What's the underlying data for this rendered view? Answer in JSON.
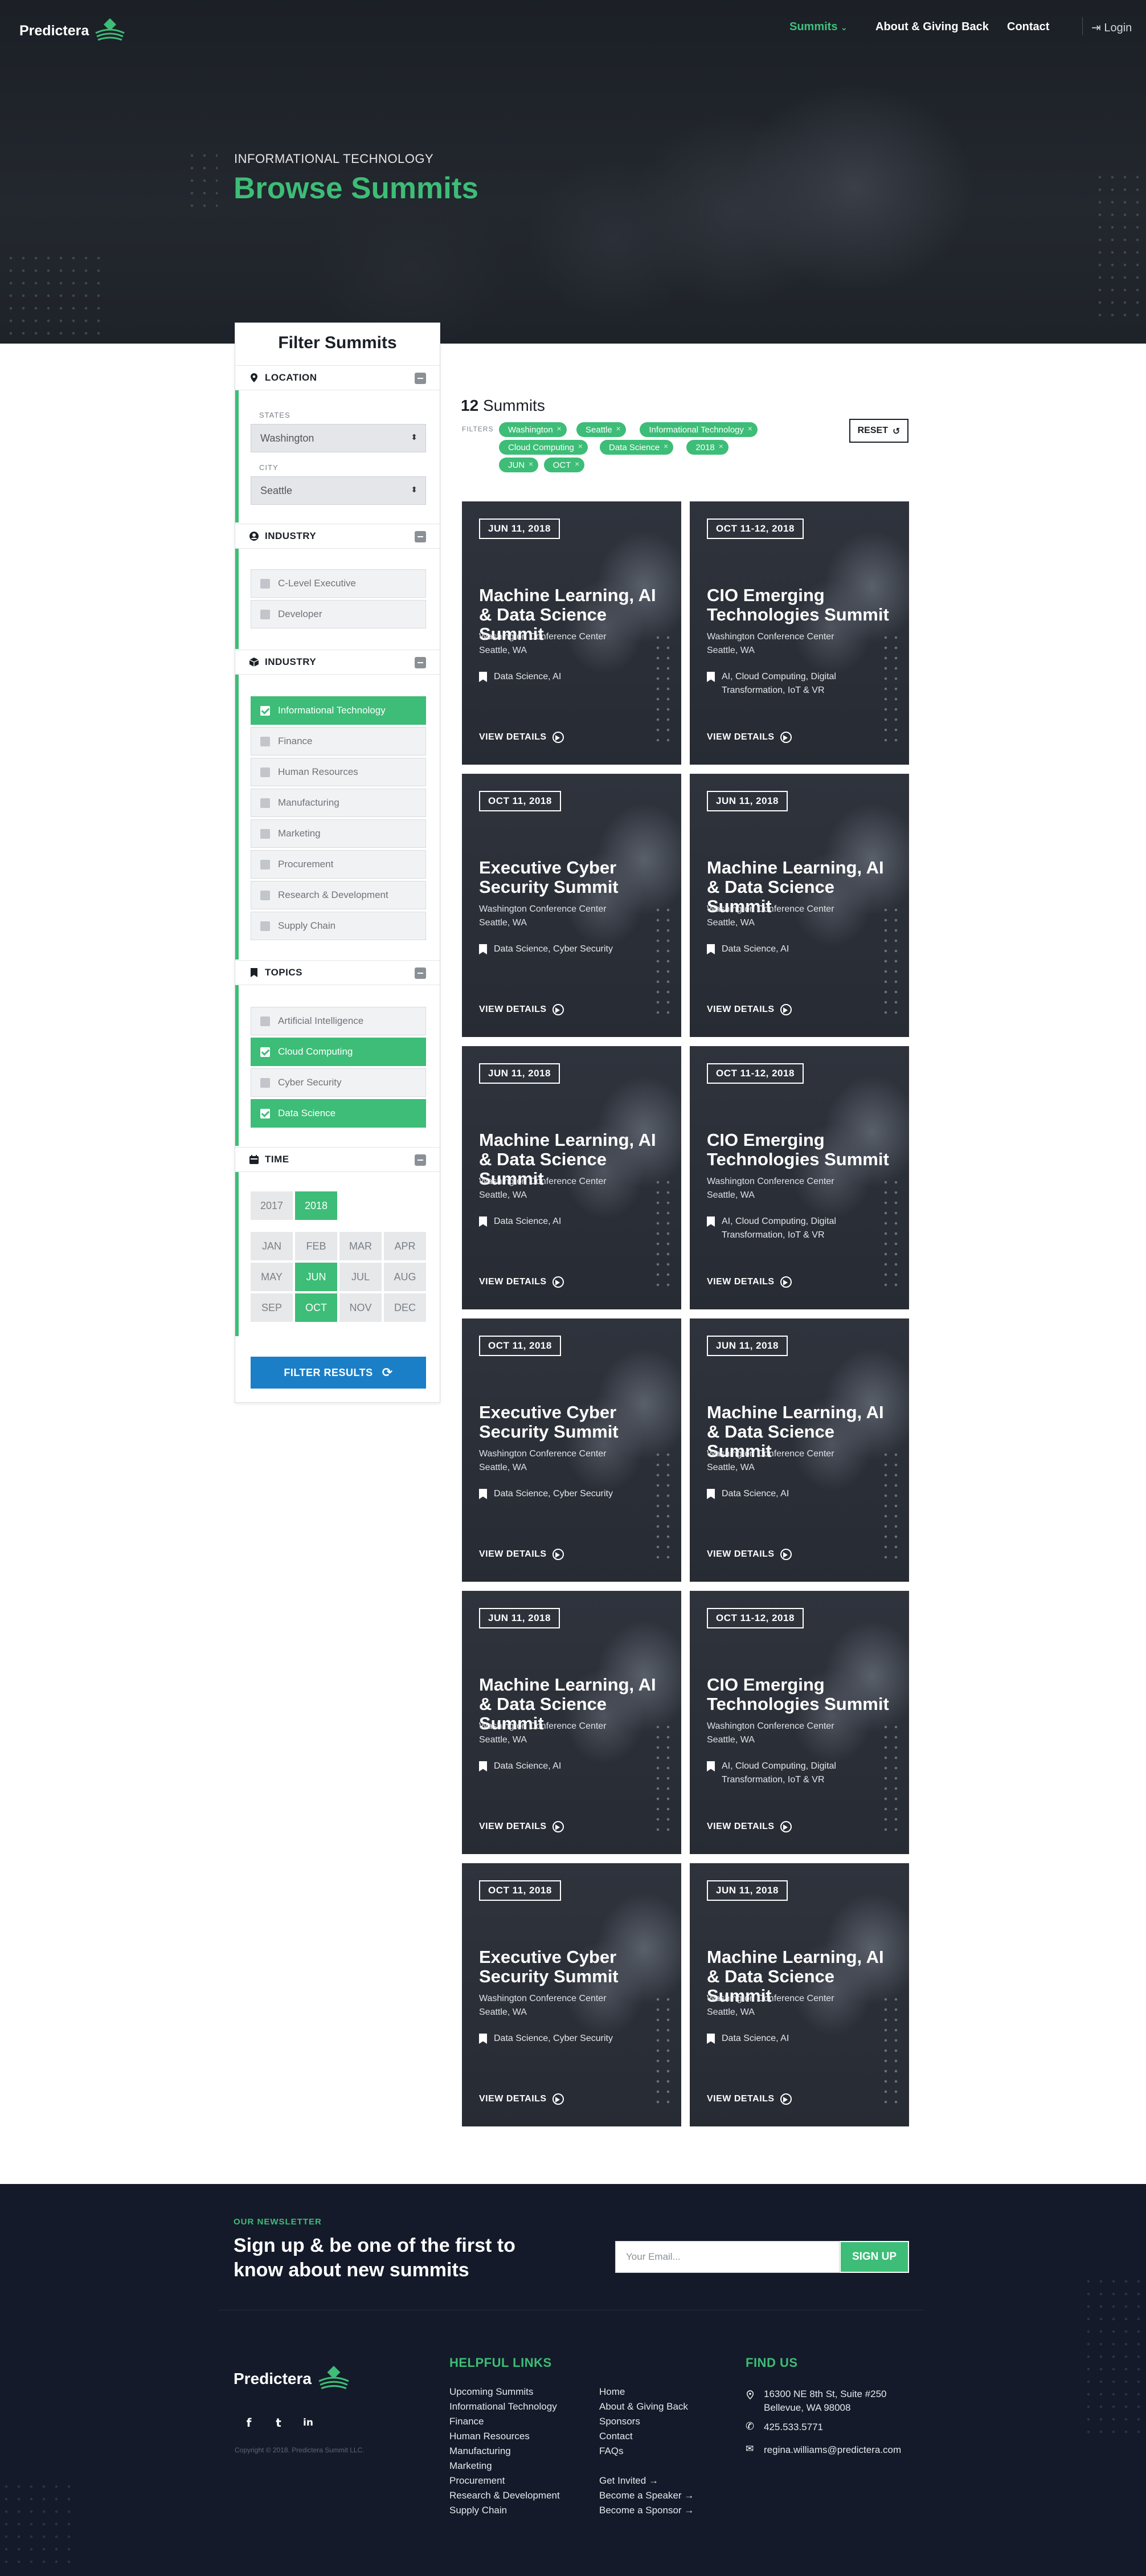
{
  "brand": {
    "name": "Predictera"
  },
  "nav": {
    "summits": "Summits",
    "about": "About & Giving Back",
    "contact": "Contact",
    "login": "Login"
  },
  "hero": {
    "kicker": "INFORMATIONAL TECHNOLOGY",
    "title": "Browse Summits"
  },
  "sidebar": {
    "title": "Filter Summits",
    "location": {
      "heading": "LOCATION",
      "states_label": "STATES",
      "states_value": "Washington",
      "city_label": "CITY",
      "city_value": "Seattle"
    },
    "role": {
      "heading": "INDUSTRY",
      "options": [
        {
          "label": "C-Level Executive",
          "checked": false
        },
        {
          "label": "Developer",
          "checked": false
        }
      ]
    },
    "industry": {
      "heading": "INDUSTRY",
      "options": [
        {
          "label": "Informational Technology",
          "checked": true
        },
        {
          "label": "Finance",
          "checked": false
        },
        {
          "label": "Human Resources",
          "checked": false
        },
        {
          "label": "Manufacturing",
          "checked": false
        },
        {
          "label": "Marketing",
          "checked": false
        },
        {
          "label": "Procurement",
          "checked": false
        },
        {
          "label": "Research & Development",
          "checked": false
        },
        {
          "label": "Supply Chain",
          "checked": false
        }
      ]
    },
    "topics": {
      "heading": "TOPICS",
      "options": [
        {
          "label": "Artificial Intelligence",
          "checked": false
        },
        {
          "label": "Cloud Computing",
          "checked": true
        },
        {
          "label": "Cyber Security",
          "checked": false
        },
        {
          "label": "Data Science",
          "checked": true
        }
      ]
    },
    "time": {
      "heading": "TIME",
      "years": [
        {
          "label": "2017",
          "selected": false
        },
        {
          "label": "2018",
          "selected": true
        }
      ],
      "months": [
        {
          "label": "JAN",
          "selected": false
        },
        {
          "label": "FEB",
          "selected": false
        },
        {
          "label": "MAR",
          "selected": false
        },
        {
          "label": "APR",
          "selected": false
        },
        {
          "label": "MAY",
          "selected": false
        },
        {
          "label": "JUN",
          "selected": true
        },
        {
          "label": "JUL",
          "selected": false
        },
        {
          "label": "AUG",
          "selected": false
        },
        {
          "label": "SEP",
          "selected": false
        },
        {
          "label": "OCT",
          "selected": true
        },
        {
          "label": "NOV",
          "selected": false
        },
        {
          "label": "DEC",
          "selected": false
        }
      ]
    },
    "filter_button": "FILTER RESULTS"
  },
  "results": {
    "count": "12",
    "count_label": "Summits",
    "filters_label": "FILTERS",
    "reset": "RESET",
    "tags": [
      "Washington",
      "Seattle",
      "Informational Technology",
      "Cloud Computing",
      "Data Science",
      "2018",
      "JUN",
      "OCT"
    ],
    "cards": [
      {
        "date": "JUN 11, 2018",
        "title": "Machine Learning, AI & Data Science Summit",
        "venue": "Washington Conference Center",
        "city": "Seattle, WA",
        "topics": "Data Science, AI",
        "cta": "VIEW DETAILS"
      },
      {
        "date": "OCT 11-12, 2018",
        "title": "CIO Emerging Technologies Summit",
        "venue": "Washington Conference Center",
        "city": "Seattle, WA",
        "topics": "AI, Cloud Computing, Digital Transformation, IoT & VR",
        "cta": "VIEW DETAILS"
      },
      {
        "date": "OCT 11, 2018",
        "title": "Executive Cyber Security Summit",
        "venue": "Washington Conference Center",
        "city": "Seattle, WA",
        "topics": "Data Science, Cyber Security",
        "cta": "VIEW DETAILS"
      },
      {
        "date": "JUN 11, 2018",
        "title": "Machine Learning, AI & Data Science Summit",
        "venue": "Washington Conference Center",
        "city": "Seattle, WA",
        "topics": "Data Science, AI",
        "cta": "VIEW DETAILS"
      },
      {
        "date": "JUN 11, 2018",
        "title": "Machine Learning, AI & Data Science Summit",
        "venue": "Washington Conference Center",
        "city": "Seattle, WA",
        "topics": "Data Science, AI",
        "cta": "VIEW DETAILS"
      },
      {
        "date": "OCT 11-12, 2018",
        "title": "CIO Emerging Technologies Summit",
        "venue": "Washington Conference Center",
        "city": "Seattle, WA",
        "topics": "AI, Cloud Computing, Digital Transformation, IoT & VR",
        "cta": "VIEW DETAILS"
      },
      {
        "date": "OCT 11, 2018",
        "title": "Executive Cyber Security Summit",
        "venue": "Washington Conference Center",
        "city": "Seattle, WA",
        "topics": "Data Science, Cyber Security",
        "cta": "VIEW DETAILS"
      },
      {
        "date": "JUN 11, 2018",
        "title": "Machine Learning, AI & Data Science Summit",
        "venue": "Washington Conference Center",
        "city": "Seattle, WA",
        "topics": "Data Science, AI",
        "cta": "VIEW DETAILS"
      },
      {
        "date": "JUN 11, 2018",
        "title": "Machine Learning, AI & Data Science Summit",
        "venue": "Washington Conference Center",
        "city": "Seattle, WA",
        "topics": "Data Science, AI",
        "cta": "VIEW DETAILS"
      },
      {
        "date": "OCT 11-12, 2018",
        "title": "CIO Emerging Technologies Summit",
        "venue": "Washington Conference Center",
        "city": "Seattle, WA",
        "topics": "AI, Cloud Computing, Digital Transformation, IoT & VR",
        "cta": "VIEW DETAILS"
      },
      {
        "date": "OCT 11, 2018",
        "title": "Executive Cyber Security Summit",
        "venue": "Washington Conference Center",
        "city": "Seattle, WA",
        "topics": "Data Science, Cyber Security",
        "cta": "VIEW DETAILS"
      },
      {
        "date": "JUN 11, 2018",
        "title": "Machine Learning, AI & Data Science Summit",
        "venue": "Washington Conference Center",
        "city": "Seattle, WA",
        "topics": "Data Science, AI",
        "cta": "VIEW DETAILS"
      }
    ]
  },
  "newsletter": {
    "kicker": "OUR NEWSLETTER",
    "title": "Sign up & be one of the first to know about new summits",
    "placeholder": "Your Email...",
    "button": "SIGN UP"
  },
  "footer": {
    "copyright": "Copyright © 2018. Predictera Summit LLC.",
    "social": [
      {
        "icon": "facebook-icon",
        "glyph": "f"
      },
      {
        "icon": "twitter-icon",
        "glyph": "t"
      },
      {
        "icon": "linkedin-icon",
        "glyph": "in"
      }
    ],
    "links_heading": "HELPFUL LINKS",
    "links_col1": [
      "Upcoming Summits",
      "Informational Technology",
      "Finance",
      "Human Resources",
      "Manufacturing",
      "Marketing",
      "Procurement",
      "Research & Development",
      "Supply Chain"
    ],
    "links_col2": [
      "Home",
      "About & Giving Back",
      "Sponsors",
      "Contact",
      "FAQs"
    ],
    "links_col2b": [
      "Get Invited",
      "Become a Speaker",
      "Become a Sponsor"
    ],
    "find_heading": "FIND US",
    "address_line1": "16300 NE 8th St, Suite #250",
    "address_line2": "Bellevue, WA 98008",
    "phone": "425.533.5771",
    "email": "regina.williams@predictera.com"
  },
  "colors": {
    "accent": "#3dbd77",
    "button_blue": "#1b7fc7",
    "dark": "#141a29"
  }
}
